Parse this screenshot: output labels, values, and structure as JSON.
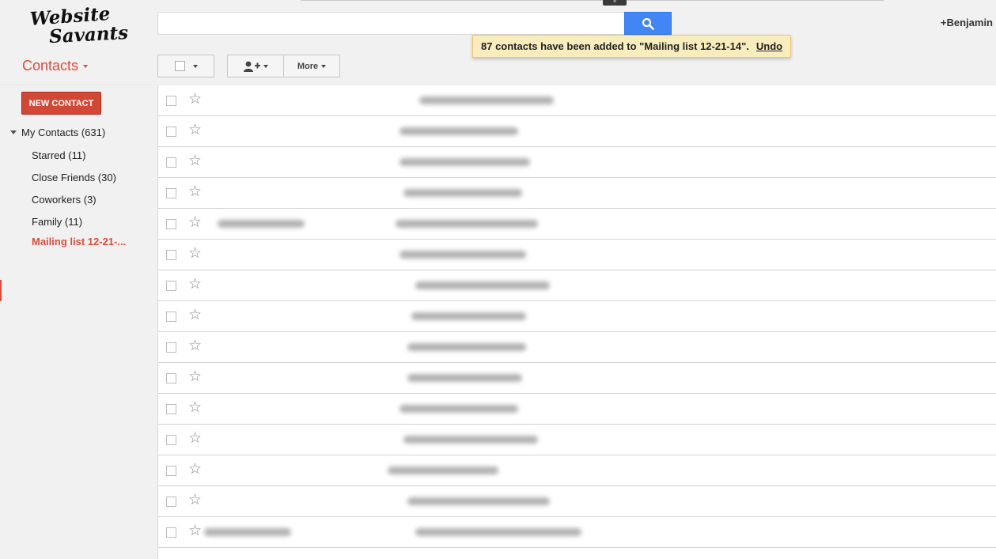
{
  "header": {
    "logo_text": "Website Savants",
    "search": {
      "value": "",
      "placeholder": ""
    },
    "user_name": "+Benjamin",
    "notification": {
      "message": "87 contacts have been added to \"Mailing list 12-21-14\".",
      "undo_label": "Undo"
    }
  },
  "toolbar": {
    "title": "Contacts",
    "more_label": "More"
  },
  "sidebar": {
    "new_contact_label": "NEW CONTACT",
    "my_contacts_label": "My Contacts (631)",
    "groups": [
      {
        "label": "Starred (11)"
      },
      {
        "label": "Close Friends (30)"
      },
      {
        "label": "Coworkers (3)"
      },
      {
        "label": "Family (11)"
      },
      {
        "label": "Mailing list 12-21-..."
      }
    ]
  },
  "contacts": {
    "row_count": 15,
    "note_names": "names and emails are blurred in the screenshot"
  },
  "colors": {
    "accent_red": "#dd4b39",
    "search_blue": "#4285f4",
    "notification_bg": "#f9edbe"
  }
}
